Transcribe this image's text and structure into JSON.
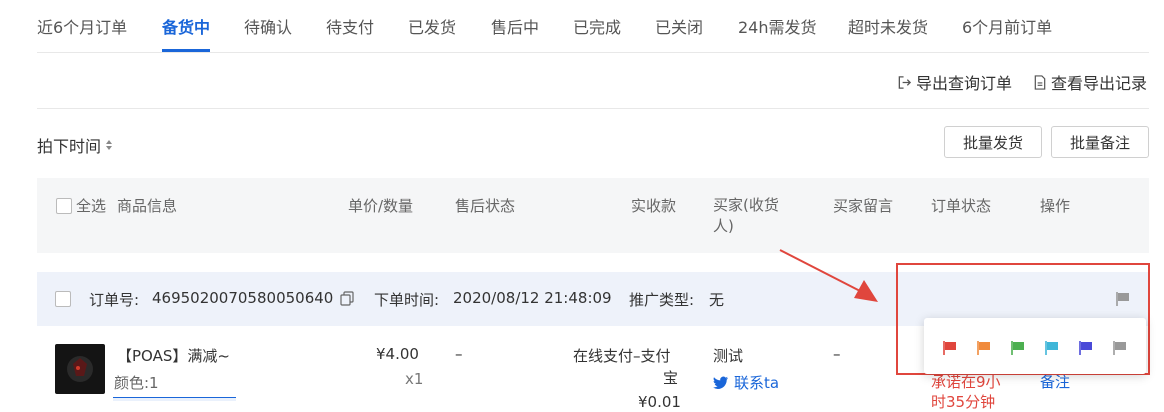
{
  "tabs": [
    {
      "label": "近6个月订单"
    },
    {
      "label": "备货中"
    },
    {
      "label": "待确认"
    },
    {
      "label": "待支付"
    },
    {
      "label": "已发货"
    },
    {
      "label": "售后中"
    },
    {
      "label": "已完成"
    },
    {
      "label": "已关闭"
    },
    {
      "label": "24h需发货"
    },
    {
      "label": "超时未发货"
    },
    {
      "label": "6个月前订单"
    }
  ],
  "active_tab": "备货中",
  "toolbar": {
    "export_label": "导出查询订单",
    "export_records_label": "查看导出记录",
    "sort_label": "拍下时间",
    "batch_ship_label": "批量发货",
    "batch_note_label": "批量备注"
  },
  "table_header": {
    "select_all": "全选",
    "product_info": "商品信息",
    "price_qty": "单价/数量",
    "after_sale": "售后状态",
    "received": "实收款",
    "buyer": "买家(收货人)",
    "buyer_msg": "买家留言",
    "order_status": "订单状态",
    "actions": "操作"
  },
  "order": {
    "order_no_label": "订单号:",
    "order_no": "4695020070580050640",
    "time_label": "下单时间:",
    "time": "2020/08/12 21:48:09",
    "promo_label": "推广类型:",
    "promo": "无",
    "product_title": "【POAS】满减~",
    "product_spec": "颜色:1",
    "price": "¥4.00",
    "qty": "x1",
    "after_sale": "–",
    "payment": "在线支付–支付",
    "payment_line2": "宝",
    "payment_amount": "¥0.01",
    "buyer_name": "测试",
    "contact": "联系ta",
    "buyer_msg": "–",
    "status_line1": "承诺在9小",
    "status_line2": "时35分钟",
    "note_link": "备注"
  },
  "flag_colors": [
    "#e0463d",
    "#f08a3c",
    "#4caf50",
    "#3fb6d8",
    "#4a4ad8",
    "#999999"
  ],
  "colors": {
    "accent": "#1a66d9",
    "highlight_box": "#e0463d",
    "status_red": "#e0463d"
  }
}
